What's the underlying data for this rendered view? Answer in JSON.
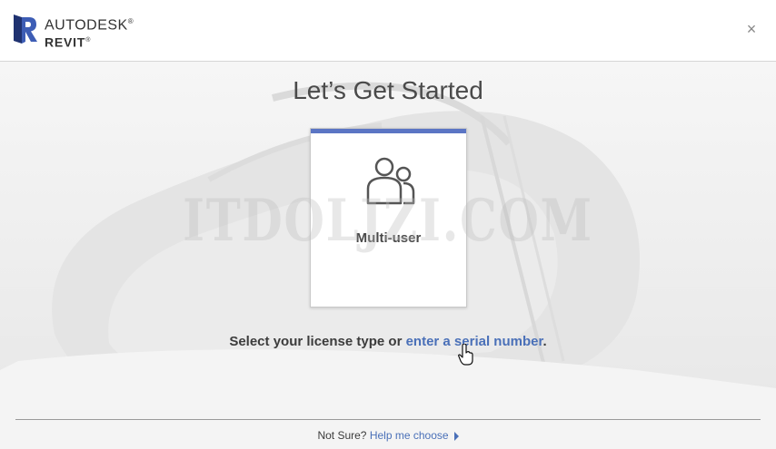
{
  "header": {
    "brand_line1": "AUTODESK",
    "brand_line1_mark": "®",
    "brand_line2": "REVIT",
    "brand_line2_mark": "®",
    "close_icon": "close-icon",
    "close_glyph": "×"
  },
  "main": {
    "title": "Let’s Get Started",
    "card": {
      "label": "Multi-user",
      "icon": "multi-user-icon",
      "accent_color": "#5b75c4"
    },
    "watermark": "ITDOLJZI.COM",
    "prompt_text": "Select your license type or ",
    "prompt_link": "enter a serial number",
    "prompt_end": "."
  },
  "footer": {
    "question": "Not Sure?",
    "help_link": "Help me choose",
    "arrow_icon": "triangle-right-icon"
  },
  "colors": {
    "link": "#4a70b8",
    "accent": "#5b75c4",
    "brand_r": "#2b3f87"
  }
}
